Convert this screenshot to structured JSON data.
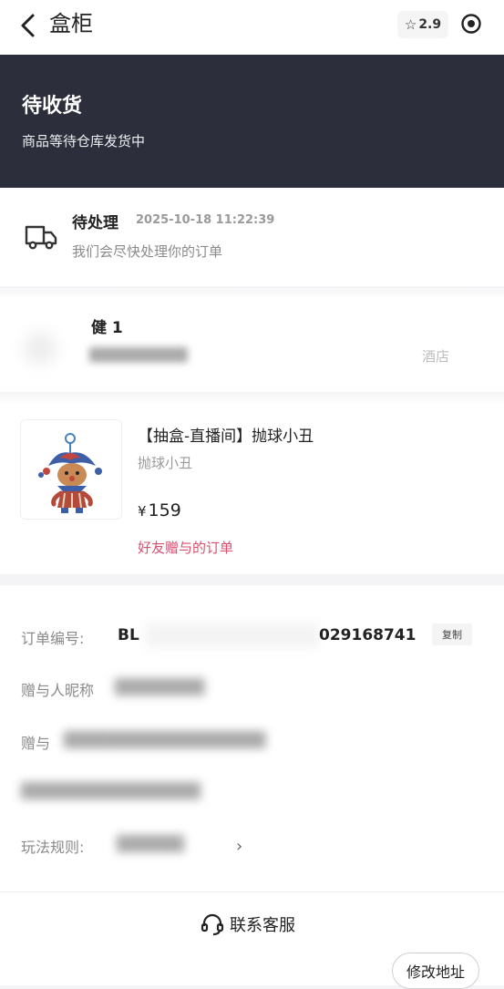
{
  "header": {
    "back_icon": "chevron-left-icon",
    "title": "盒柜",
    "score": "2.9",
    "star_icon": "star-outline-icon",
    "target_icon": "target-icon"
  },
  "status": {
    "title": "待收货",
    "subtitle": "商品等待仓库发货中"
  },
  "process": {
    "icon": "truck-icon",
    "title": "待处理",
    "time": "2025-10-18 11:22:39",
    "desc": "我们会尽快处理你的订单"
  },
  "address": {
    "name_visible": "健 1",
    "store_visible": "酒店"
  },
  "product": {
    "title": "【抽盒-直播间】抛球小丑",
    "subtitle": "抛球小丑",
    "currency": "¥",
    "price": "159",
    "gift_note": "好友赠与的订单"
  },
  "info": {
    "order_label": "订单编号:",
    "order_prefix": "BL",
    "order_suffix": "029168741",
    "copy_label": "复制",
    "giver_nick_label": "赠与人昵称",
    "giver_label": "赠与",
    "rules_label": "玩法规则:",
    "chevron": "›"
  },
  "footer": {
    "service_label": "联系客服",
    "modify_label": "修改地址"
  },
  "colors": {
    "banner_bg": "#2c2e3b",
    "gift_text": "#d8506e"
  }
}
